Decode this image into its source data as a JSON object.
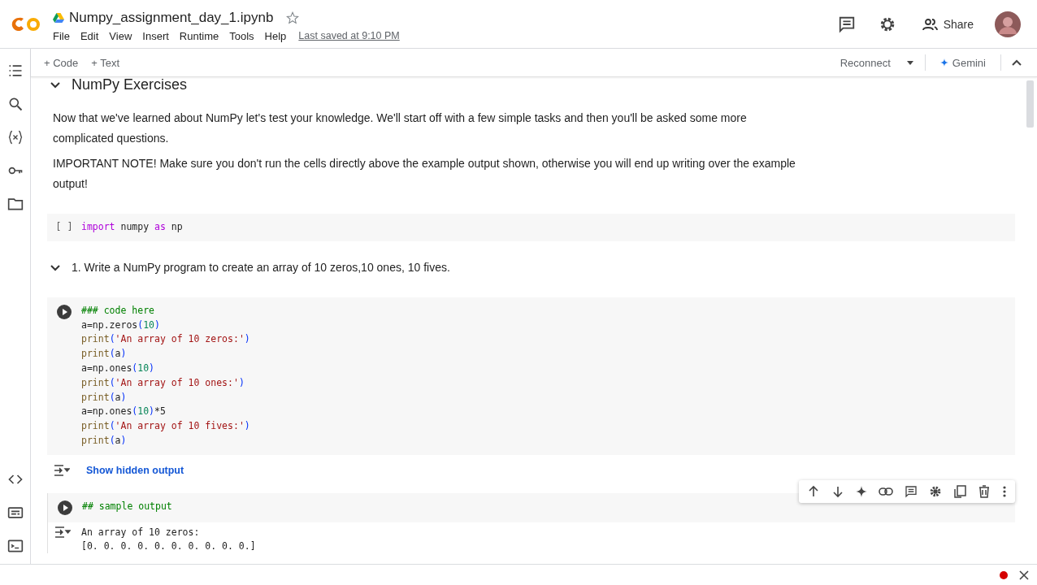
{
  "header": {
    "title": "Numpy_assignment_day_1.ipynb",
    "starred": false,
    "menu": [
      "File",
      "Edit",
      "View",
      "Insert",
      "Runtime",
      "Tools",
      "Help"
    ],
    "last_saved": "Last saved at 9:10 PM",
    "share": "Share"
  },
  "toolbar": {
    "add": [
      "+ Code",
      "+ Text"
    ],
    "reconnect": "Reconnect",
    "gemini": "Gemini"
  },
  "cells": [
    {
      "kind": "heading",
      "title": "NumPy Exercises",
      "expanded": true
    },
    {
      "kind": "paragraph",
      "text": "Now that we've learned about NumPy let's test your knowledge. We'll start off with a few simple tasks and then you'll be asked some more complicated questions."
    },
    {
      "kind": "paragraph",
      "text": "IMPORTANT NOTE! Make sure you don't run the cells directly above the example output shown, otherwise you will end up writing over the example output!"
    },
    {
      "kind": "code",
      "prompt": "[ ]",
      "lines": [
        [
          {
            "t": "import",
            "kind": "keyword"
          },
          {
            "t": " numpy ",
            "kind": "name"
          },
          {
            "t": "as",
            "kind": "keyword"
          },
          {
            "t": " np",
            "kind": "name"
          }
        ]
      ]
    },
    {
      "kind": "heading",
      "title": "1. Write a NumPy program to create an array of 10 zeros,10 ones, 10 fives.",
      "expanded": true
    },
    {
      "kind": "code",
      "lines": [
        [
          {
            "t": "### code here",
            "kind": "comment"
          }
        ],
        [
          {
            "t": "a=np.zeros",
            "kind": "name"
          },
          {
            "t": "(",
            "kind": "paren"
          },
          {
            "t": "10",
            "kind": "number"
          },
          {
            "t": ")",
            "kind": "paren"
          }
        ],
        [
          {
            "t": "print",
            "kind": "builtin"
          },
          {
            "t": "(",
            "kind": "paren"
          },
          {
            "t": "'An array of 10 zeros:'",
            "kind": "string"
          },
          {
            "t": ")",
            "kind": "paren"
          }
        ],
        [
          {
            "t": "print",
            "kind": "builtin"
          },
          {
            "t": "(",
            "kind": "paren"
          },
          {
            "t": "a",
            "kind": "name"
          },
          {
            "t": ")",
            "kind": "paren"
          }
        ],
        [
          {
            "t": "a=np.ones",
            "kind": "name"
          },
          {
            "t": "(",
            "kind": "paren"
          },
          {
            "t": "10",
            "kind": "number"
          },
          {
            "t": ")",
            "kind": "paren"
          }
        ],
        [
          {
            "t": "print",
            "kind": "builtin"
          },
          {
            "t": "(",
            "kind": "paren"
          },
          {
            "t": "'An array of 10 ones:'",
            "kind": "string"
          },
          {
            "t": ")",
            "kind": "paren"
          }
        ],
        [
          {
            "t": "print",
            "kind": "builtin"
          },
          {
            "t": "(",
            "kind": "paren"
          },
          {
            "t": "a",
            "kind": "name"
          },
          {
            "t": ")",
            "kind": "paren"
          }
        ],
        [
          {
            "t": "a=np.ones",
            "kind": "name"
          },
          {
            "t": "(",
            "kind": "paren"
          },
          {
            "t": "10",
            "kind": "number"
          },
          {
            "t": ")",
            "kind": "paren"
          },
          {
            "t": "*5",
            "kind": "name"
          }
        ],
        [
          {
            "t": "print",
            "kind": "builtin"
          },
          {
            "t": "(",
            "kind": "paren"
          },
          {
            "t": "'An array of 10 fives:'",
            "kind": "string"
          },
          {
            "t": ")",
            "kind": "paren"
          }
        ],
        [
          {
            "t": "print",
            "kind": "builtin"
          },
          {
            "t": "(",
            "kind": "paren"
          },
          {
            "t": "a",
            "kind": "name"
          },
          {
            "t": ")",
            "kind": "paren"
          }
        ]
      ]
    },
    {
      "kind": "hidden_output",
      "text": "Show hidden output"
    },
    {
      "kind": "code",
      "selected": true,
      "lines": [
        [
          {
            "t": "## sample output",
            "kind": "comment"
          }
        ]
      ],
      "output": [
        "An array of 10 zeros:",
        "[0. 0. 0. 0. 0. 0. 0. 0. 0. 0.]"
      ]
    }
  ]
}
